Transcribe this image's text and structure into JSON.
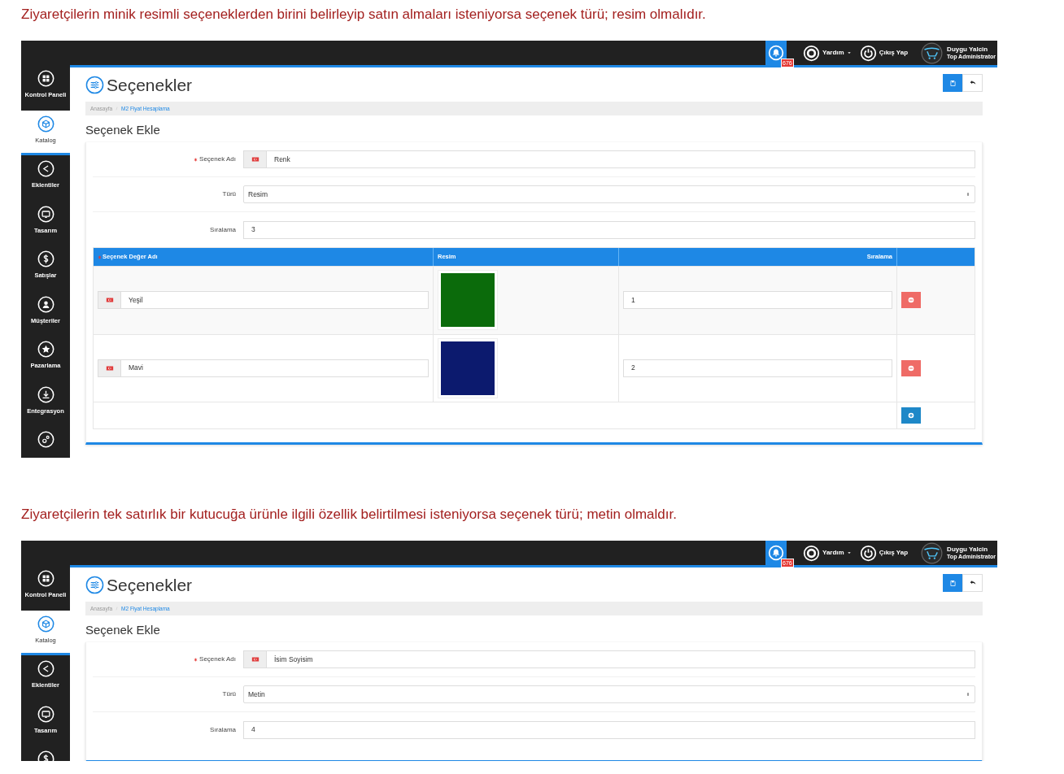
{
  "sections": [
    {
      "caption": "Ziyaretçilerin minik resimli seçeneklerden birini belirleyip satın almaları isteniyorsa seçenek türü; resim olmalıdır.",
      "screenshot": {
        "topbar": {
          "notifications": "676",
          "help": "Yardım",
          "logout": "Çıkış Yap",
          "user_name": "Duygu Yalcin",
          "user_role": "Top Administrator"
        },
        "sidebar": [
          {
            "label": "Kontrol Paneli",
            "selected": false
          },
          {
            "label": "Katalog",
            "selected": true
          },
          {
            "label": "Eklentiler",
            "selected": false
          },
          {
            "label": "Tasarım",
            "selected": false
          },
          {
            "label": "Satışlar",
            "selected": false
          },
          {
            "label": "Müşteriler",
            "selected": false
          },
          {
            "label": "Pazarlama",
            "selected": false
          },
          {
            "label": "Entegrasyon",
            "selected": false
          },
          {
            "selected": false
          }
        ],
        "page_title": "Seçenekler",
        "breadcrumb": [
          "Anasayfa",
          "M2 Fiyat Hesaplama"
        ],
        "section_title": "Seçenek Ekle",
        "form": [
          {
            "kind": "lang-input",
            "label": "Seçenek Adı",
            "required": true,
            "value": "Renk"
          },
          {
            "kind": "select",
            "label": "Türü",
            "required": false,
            "value": "Resim"
          },
          {
            "kind": "input",
            "label": "Sıralama",
            "required": false,
            "value": "3"
          }
        ],
        "values_table": {
          "columns": [
            {
              "label": "Seçenek Değer Adı",
              "required": true
            },
            {
              "label": "Resim",
              "required": false
            },
            {
              "label": "Sıralama",
              "required": false
            }
          ],
          "rows": [
            {
              "name": "Yeşil",
              "color": "#0b6b0b",
              "order": "1"
            },
            {
              "name": "Mavi",
              "color": "#0c1a6e",
              "order": "2"
            }
          ]
        }
      }
    },
    {
      "caption": "Ziyaretçilerin tek satırlık bir kutucuğa ürünle ilgili özellik belirtilmesi isteniyorsa seçenek türü; metin olmaldır.",
      "screenshot": {
        "topbar": {
          "notifications": "676",
          "help": "Yardım",
          "logout": "Çıkış Yap",
          "user_name": "Duygu Yalcin",
          "user_role": "Top Administrator"
        },
        "sidebar": [
          {
            "label": "Kontrol Paneli",
            "selected": false
          },
          {
            "label": "Katalog",
            "selected": true
          },
          {
            "label": "Eklentiler",
            "selected": false
          },
          {
            "label": "Tasarım",
            "selected": false
          },
          {
            "selected": false
          }
        ],
        "page_title": "Seçenekler",
        "breadcrumb": [
          "Anasayfa",
          "M2 Fiyat Hesaplama"
        ],
        "section_title": "Seçenek Ekle",
        "form": [
          {
            "kind": "lang-input",
            "label": "Seçenek Adı",
            "required": true,
            "value": "İsim Soyisim"
          },
          {
            "kind": "select",
            "label": "Türü",
            "required": false,
            "value": "Metin"
          },
          {
            "kind": "input",
            "label": "Sıralama",
            "required": false,
            "value": "4"
          }
        ]
      }
    }
  ]
}
